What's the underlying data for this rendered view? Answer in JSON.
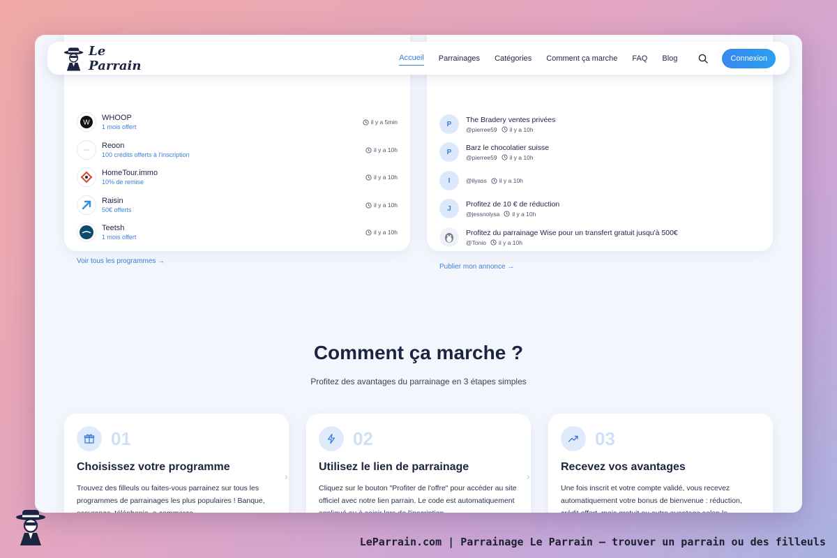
{
  "nav": {
    "logo": "Le Parrain",
    "links": [
      "Accueil",
      "Parrainages",
      "Catégories",
      "Comment ça marche",
      "FAQ",
      "Blog"
    ],
    "login": "Connexion"
  },
  "programs": {
    "items": [
      {
        "name": "WHOOP",
        "offer": "1 mois offert",
        "time": "il y a 5min",
        "icon": "whoop-logo"
      },
      {
        "name": "Reoon",
        "offer": "100 crédits offerts à l'inscription",
        "time": "il y a 10h",
        "icon": "reoon-logo"
      },
      {
        "name": "HomeTour.immo",
        "offer": "10% de remise",
        "time": "il y a 10h",
        "icon": "hometour-logo"
      },
      {
        "name": "Raisin",
        "offer": "50€ offerts",
        "time": "il y a 10h",
        "icon": "raisin-logo"
      },
      {
        "name": "Teetsh",
        "offer": "1 mois offert",
        "time": "il y a 10h",
        "icon": "teetsh-logo"
      }
    ],
    "see_all": "Voir tous les programmes →"
  },
  "posts": {
    "items": [
      {
        "avatar": "P",
        "title": "The Bradery ventes privées",
        "user": "@pierree59",
        "time": "il y a 10h"
      },
      {
        "avatar": "P",
        "title": "Barz le chocolatier suisse",
        "user": "@pierree59",
        "time": "il y a 10h"
      },
      {
        "avatar": "I",
        "title": "",
        "user": "@ilyass",
        "time": "il y a 10h"
      },
      {
        "avatar": "J",
        "title": "Profitez de 10 € de réduction",
        "user": "@jessnolysa",
        "time": "il y a 10h"
      },
      {
        "avatar": "",
        "title": "Profitez du parrainage Wise pour un transfert gratuit jusqu'à 500€",
        "user": "@Tonio",
        "time": "il y a 10h"
      }
    ],
    "publish": "Publier mon annonce →"
  },
  "how": {
    "title": "Comment ça marche ?",
    "subtitle": "Profitez des avantages du parrainage en 3 étapes simples",
    "steps": [
      {
        "num": "01",
        "icon": "gift-icon",
        "title": "Choisissez votre programme",
        "desc": "Trouvez des filleuls ou faites-vous parrainez sur tous les programmes de parrainages les plus populaires ! Banque, assurance, téléphonie, e-commerce..."
      },
      {
        "num": "02",
        "icon": "lightning-icon",
        "title": "Utilisez le lien de parrainage",
        "desc": "Cliquez sur le bouton \"Profiter de l'offre\" pour accéder au site officiel avec notre lien parrain. Le code est automatiquement appliqué ou à saisir lors de l'inscription."
      },
      {
        "num": "03",
        "icon": "trending-up-icon",
        "title": "Recevez vos avantages",
        "desc": "Une fois inscrit et votre compte validé, vous recevez automatiquement votre bonus de bienvenue : réduction, crédit offert, mois gratuit ou autre avantage selon le programme."
      }
    ]
  },
  "footer": {
    "caption": "LeParrain.com | Parrainage Le Parrain — trouver un parrain ou des filleuls"
  },
  "colors": {
    "accent": "#2f7de1",
    "text": "#1b2440",
    "background": "#f3f6fc"
  }
}
